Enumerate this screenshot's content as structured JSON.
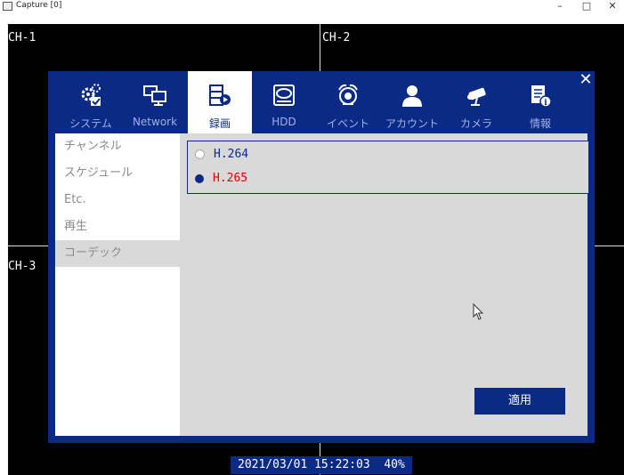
{
  "window": {
    "title": "Capture [0]",
    "minimize": "–",
    "maximize": "□",
    "close": "✕"
  },
  "channels": [
    "CH-1",
    "CH-2",
    "CH-3"
  ],
  "dialog": {
    "close": "✕",
    "tabs": [
      {
        "label": "システム",
        "icon": "gear-check-icon"
      },
      {
        "label": "Network",
        "icon": "network-monitor-icon"
      },
      {
        "label": "録画",
        "icon": "record-film-icon"
      },
      {
        "label": "HDD",
        "icon": "hdd-icon"
      },
      {
        "label": "イベント",
        "icon": "alarm-bell-icon"
      },
      {
        "label": "アカウント",
        "icon": "user-icon"
      },
      {
        "label": "カメラ",
        "icon": "camera-icon"
      },
      {
        "label": "情報",
        "icon": "info-document-icon"
      }
    ],
    "active_tab": "録画",
    "sidebar": [
      "チャンネル",
      "スケジュール",
      "Etc.",
      "再生",
      "コーデック"
    ],
    "active_sidebar": "コーデック",
    "codec_options": [
      {
        "label": "H.264",
        "selected": false
      },
      {
        "label": "H.265",
        "selected": true
      }
    ],
    "selected_color": "#e00000",
    "apply": "適用"
  },
  "status_bar": "2021/03/01 15:22:03  40%",
  "accent_color": "#0b2a86"
}
